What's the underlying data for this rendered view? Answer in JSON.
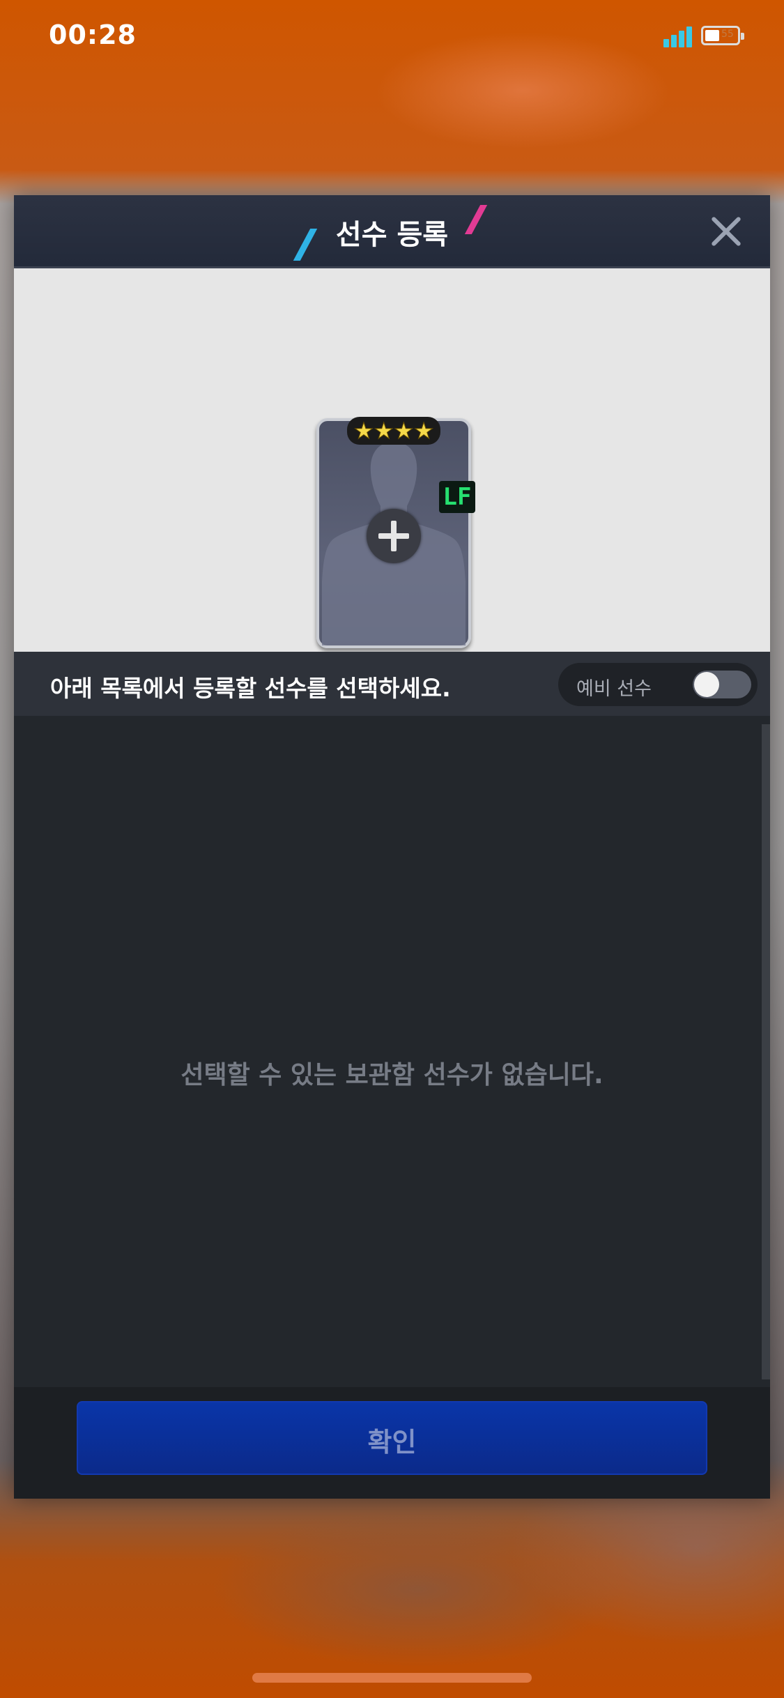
{
  "status_bar": {
    "time": "00:28",
    "battery_level": "55"
  },
  "modal": {
    "title": "선수 등록",
    "player_card": {
      "stars": [
        "★",
        "★",
        "★",
        "★"
      ],
      "position": "LF"
    },
    "instruction": "아래 목록에서 등록할 선수를 선택하세요.",
    "reserve_toggle": {
      "label": "예비 선수",
      "on": false
    },
    "empty_message": "선택할 수 있는 보관함 선수가 없습니다.",
    "confirm_label": "확인"
  },
  "colors": {
    "accent_blue": "#2fb3e6",
    "accent_pink": "#e23b94",
    "confirm_button": "#0a35a8",
    "position_badge": "#26e070"
  }
}
